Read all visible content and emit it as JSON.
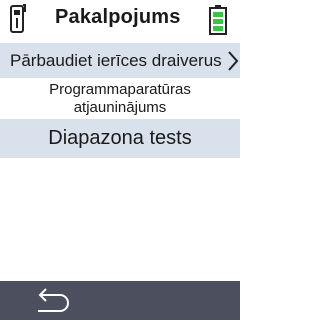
{
  "header": {
    "title": "Pakalpojums",
    "device_icon": "pager-device-icon",
    "battery_icon": "battery-full-icon",
    "battery_color": "#3cc24a"
  },
  "menu": {
    "items": [
      {
        "label": "Pārbaudiet ierīces draiverus",
        "has_chevron": true,
        "highlighted": true
      },
      {
        "label_line1": "Programmaparatūras",
        "label_line2": "atjauninājums",
        "highlighted": false
      },
      {
        "label": "Diapazona tests",
        "highlighted": true
      }
    ]
  },
  "footer": {
    "back_icon": "back-arrow-icon",
    "bar_color": "#4c4f5d"
  }
}
